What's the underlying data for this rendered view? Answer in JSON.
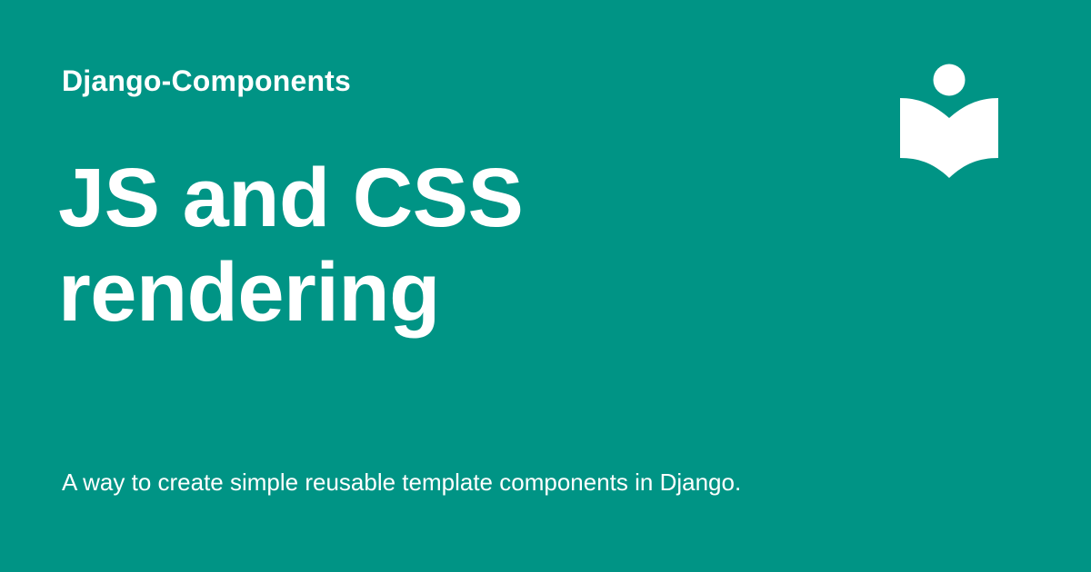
{
  "header": {
    "site_name": "Django-Components",
    "logo_icon": "open-book-reader-icon"
  },
  "main": {
    "title_line_1": "JS and CSS",
    "title_line_2": "rendering",
    "description": "A way to create simple reusable template components in Django."
  },
  "colors": {
    "background": "#009485",
    "text": "#ffffff"
  }
}
